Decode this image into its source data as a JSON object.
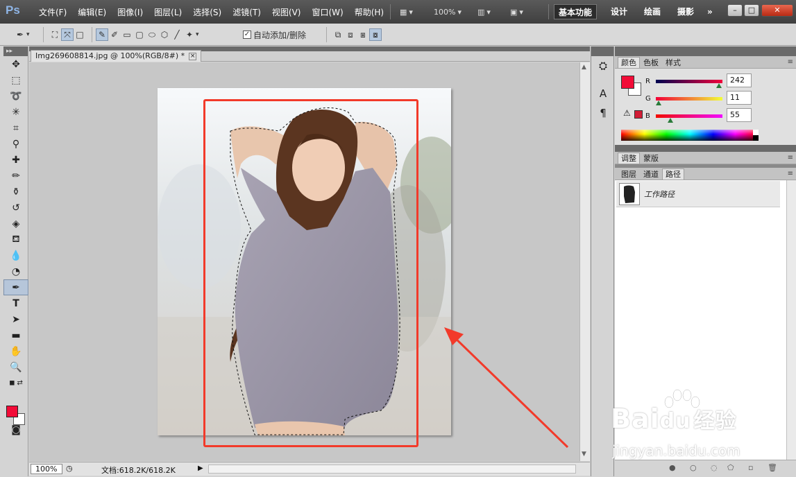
{
  "app": {
    "logo": "Ps",
    "menus": [
      "文件(F)",
      "编辑(E)",
      "图像(I)",
      "图层(L)",
      "选择(S)",
      "滤镜(T)",
      "视图(V)",
      "窗口(W)",
      "帮助(H)"
    ],
    "zoom_dropdown": "100%",
    "workspaces": [
      "基本功能",
      "设计",
      "绘画",
      "摄影"
    ],
    "active_workspace": "基本功能",
    "more": "»",
    "window_controls": [
      "–",
      "□",
      "✕"
    ]
  },
  "options": {
    "auto_add_delete_label": "自动添加/删除",
    "auto_add_delete_checked": true
  },
  "document": {
    "tab_title": "Img269608814.jpg @ 100%(RGB/8#) *",
    "zoom": "100%",
    "doc_info": "文档:618.2K/618.2K"
  },
  "color_panel": {
    "tabs": [
      "颜色",
      "色板",
      "样式"
    ],
    "active_tab": "颜色",
    "channels": [
      {
        "label": "R",
        "value": "242",
        "fraction": 0.949
      },
      {
        "label": "G",
        "value": "11",
        "fraction": 0.043
      },
      {
        "label": "B",
        "value": "55",
        "fraction": 0.216
      }
    ],
    "foreground": "#f20b37",
    "background": "#ffffff"
  },
  "adjust_panel": {
    "tabs": [
      "调整",
      "蒙版"
    ]
  },
  "layers_panel": {
    "tabs": [
      "图层",
      "通道",
      "路径"
    ],
    "active_tab": "路径",
    "paths": [
      {
        "name": "工作路径"
      }
    ]
  },
  "watermark": {
    "brand": "Bai",
    "brand_suffix": "du",
    "brand_cn": "经验",
    "url": "jingyan.baidu.com"
  },
  "colors": {
    "annotation_red": "#f23a2a",
    "accent": "#f20b37"
  }
}
